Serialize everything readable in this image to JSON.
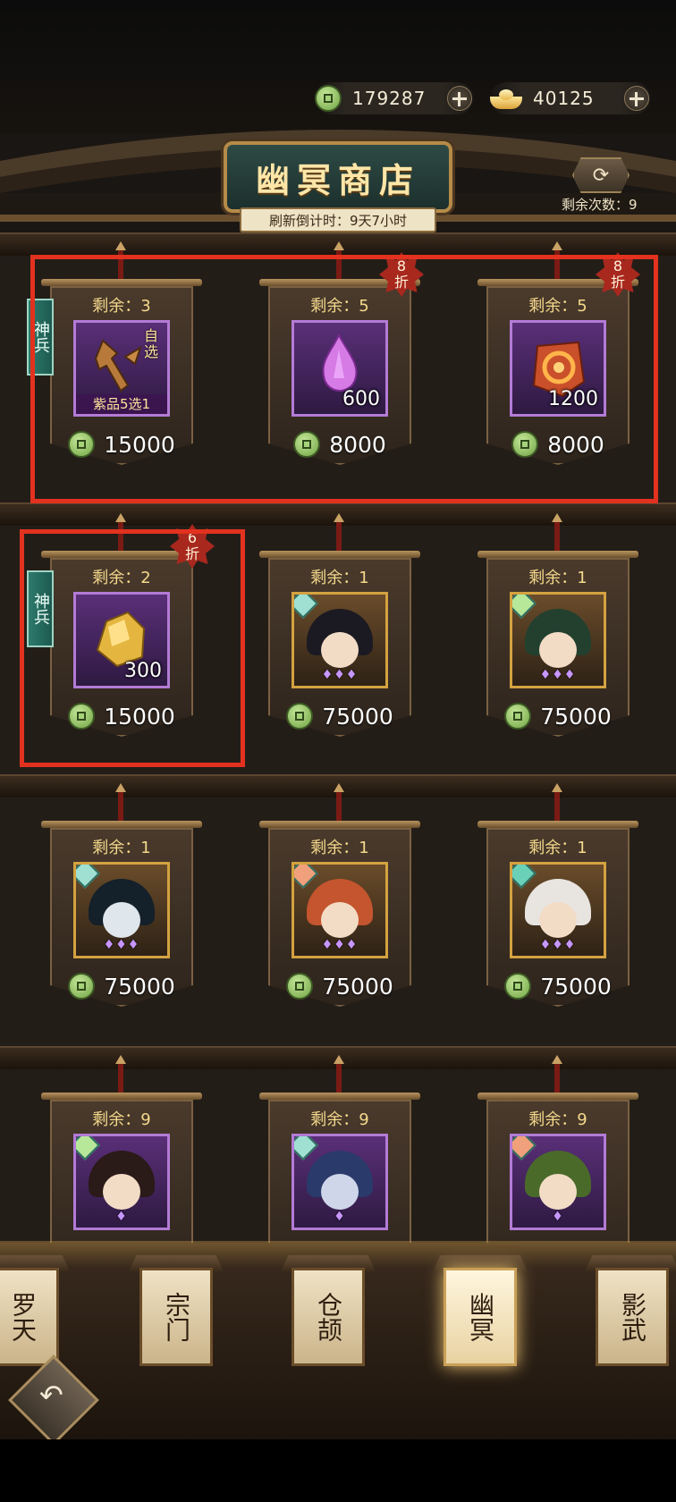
{
  "header": {
    "jade_amount": "179287",
    "gold_amount": "40125",
    "shop_title": "幽冥商店",
    "refresh_countdown": "刷新倒计时：9天7小时",
    "refresh_remaining": "剩余次数：9"
  },
  "items": [
    {
      "remain": "剩余：3",
      "price": "15000",
      "tag": "神兵",
      "pick_label": "自选",
      "bottom_label": "紫品5选1",
      "icon": "weapon-select-icon"
    },
    {
      "remain": "剩余：5",
      "price": "8000",
      "discount_num": "8",
      "discount_word": "折",
      "qty": "600",
      "icon": "purple-crystal-icon"
    },
    {
      "remain": "剩余：5",
      "price": "8000",
      "discount_num": "8",
      "discount_word": "折",
      "qty": "1200",
      "icon": "fire-gem-icon"
    },
    {
      "remain": "剩余：2",
      "price": "15000",
      "discount_num": "6",
      "discount_word": "折",
      "tag": "神兵",
      "qty": "300",
      "icon": "gold-ore-icon"
    },
    {
      "remain": "剩余：1",
      "price": "75000",
      "icon": "hero-portrait-icon"
    },
    {
      "remain": "剩余：1",
      "price": "75000",
      "icon": "hero-portrait-icon"
    },
    {
      "remain": "剩余：1",
      "price": "75000",
      "icon": "hero-portrait-icon"
    },
    {
      "remain": "剩余：1",
      "price": "75000",
      "icon": "hero-portrait-icon"
    },
    {
      "remain": "剩余：1",
      "price": "75000",
      "icon": "hero-portrait-icon"
    },
    {
      "remain": "剩余：9",
      "icon": "hero-portrait-icon"
    },
    {
      "remain": "剩余：9",
      "icon": "hero-portrait-icon"
    },
    {
      "remain": "剩余：9",
      "icon": "hero-portrait-icon"
    }
  ],
  "tabs": [
    {
      "label": "罗天"
    },
    {
      "label": "宗门"
    },
    {
      "label": "仓颉"
    },
    {
      "label": "幽冥",
      "active": true
    },
    {
      "label": "影武"
    }
  ],
  "colors": {
    "highlight_box": "#e2321f",
    "price_coin": "#6fa343",
    "purple_frame": "#b37bd6",
    "gold_frame": "#d4a240"
  }
}
